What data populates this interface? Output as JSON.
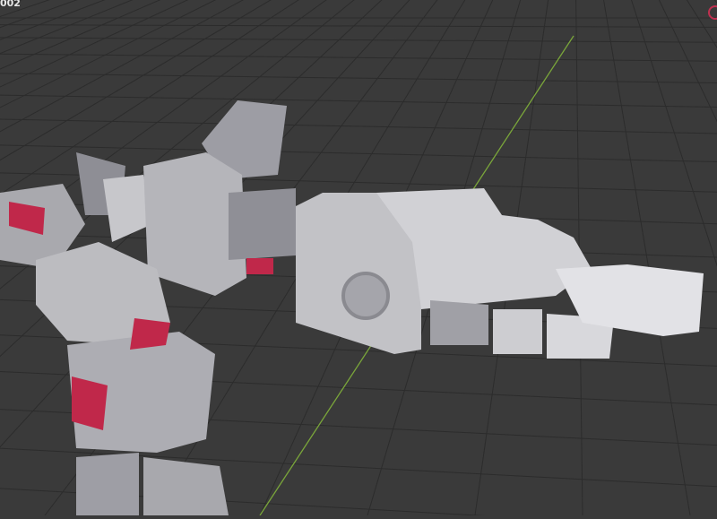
{
  "viewport": {
    "object_label": "002",
    "background_color": "#3a3a3a",
    "grid_color": "#2f2f2f",
    "y_axis_color": "#7aa63a",
    "model_color": "#b8b8bc",
    "accent_color": "#c0284a"
  }
}
